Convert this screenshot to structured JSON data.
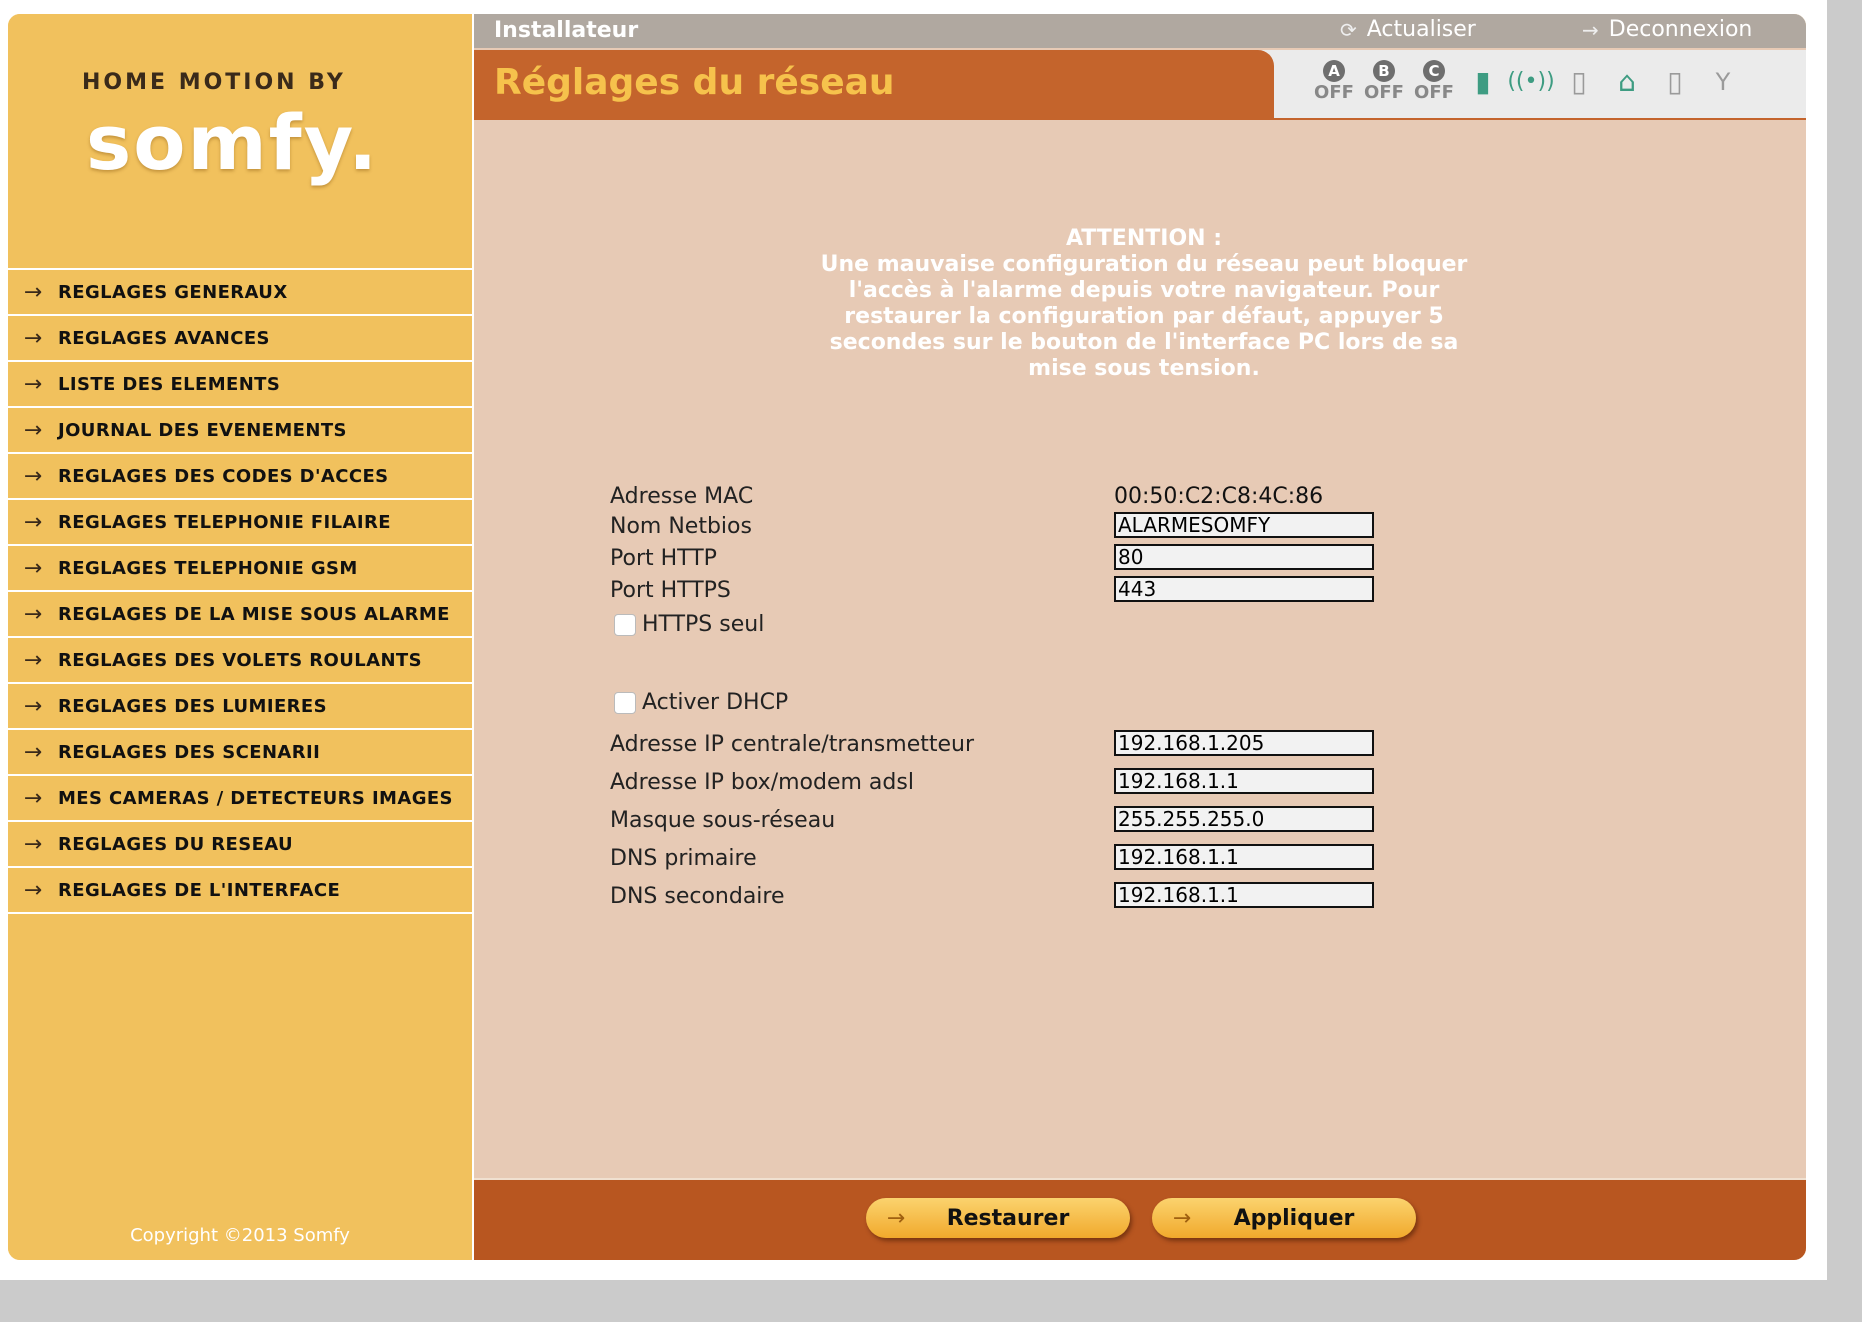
{
  "sidebar": {
    "logo_top": "HOME MOTION BY",
    "logo_main": "somfy.",
    "items": [
      {
        "label": "REGLAGES GENERAUX"
      },
      {
        "label": "REGLAGES AVANCES"
      },
      {
        "label": "LISTE DES ELEMENTS"
      },
      {
        "label": "JOURNAL DES EVENEMENTS"
      },
      {
        "label": "REGLAGES DES CODES D'ACCES"
      },
      {
        "label": "REGLAGES TELEPHONIE FILAIRE"
      },
      {
        "label": "REGLAGES TELEPHONIE GSM"
      },
      {
        "label": "REGLAGES DE LA MISE SOUS ALARME"
      },
      {
        "label": "REGLAGES DES VOLETS ROULANTS"
      },
      {
        "label": "REGLAGES DES LUMIERES"
      },
      {
        "label": "REGLAGES DES SCENARII"
      },
      {
        "label": "MES CAMERAS / DETECTEURS IMAGES"
      },
      {
        "label": "REGLAGES DU RESEAU"
      },
      {
        "label": "REGLAGES DE L'INTERFACE"
      }
    ],
    "copyright": "Copyright ©2013 Somfy"
  },
  "topbar": {
    "title": "Installateur",
    "refresh_label": "Actualiser",
    "logout_label": "Deconnexion"
  },
  "header": {
    "page_title": "Réglages du réseau",
    "zones": [
      {
        "letter": "A",
        "state": "OFF"
      },
      {
        "letter": "B",
        "state": "OFF"
      },
      {
        "letter": "C",
        "state": "OFF"
      }
    ]
  },
  "warning": {
    "title": "ATTENTION :",
    "text": "Une mauvaise configuration du réseau peut bloquer l'accès à l'alarme depuis votre navigateur. Pour restaurer la configuration par défaut, appuyer 5 secondes sur le bouton de l'interface PC lors de sa mise sous tension."
  },
  "form": {
    "mac_label": "Adresse MAC",
    "mac_value": "00:50:C2:C8:4C:86",
    "netbios_label": "Nom Netbios",
    "netbios_value": "ALARMESOMFY",
    "http_label": "Port HTTP",
    "http_value": "80",
    "https_label": "Port HTTPS",
    "https_value": "443",
    "https_only_label": "HTTPS seul",
    "dhcp_label": "Activer DHCP",
    "ip_label": "Adresse IP centrale/transmetteur",
    "ip_value": "192.168.1.205",
    "gateway_label": "Adresse IP box/modem adsl",
    "gateway_value": "192.168.1.1",
    "mask_label": "Masque sous-réseau",
    "mask_value": "255.255.255.0",
    "dns1_label": "DNS primaire",
    "dns1_value": "192.168.1.1",
    "dns2_label": "DNS secondaire",
    "dns2_value": "192.168.1.1"
  },
  "footer": {
    "restore_label": "Restaurer",
    "apply_label": "Appliquer"
  },
  "colors": {
    "sidebar": "#f1c15d",
    "content": "#e7cab5",
    "title_tab": "#c4642c",
    "title_text": "#f6c24c",
    "footer": "#b85620"
  }
}
